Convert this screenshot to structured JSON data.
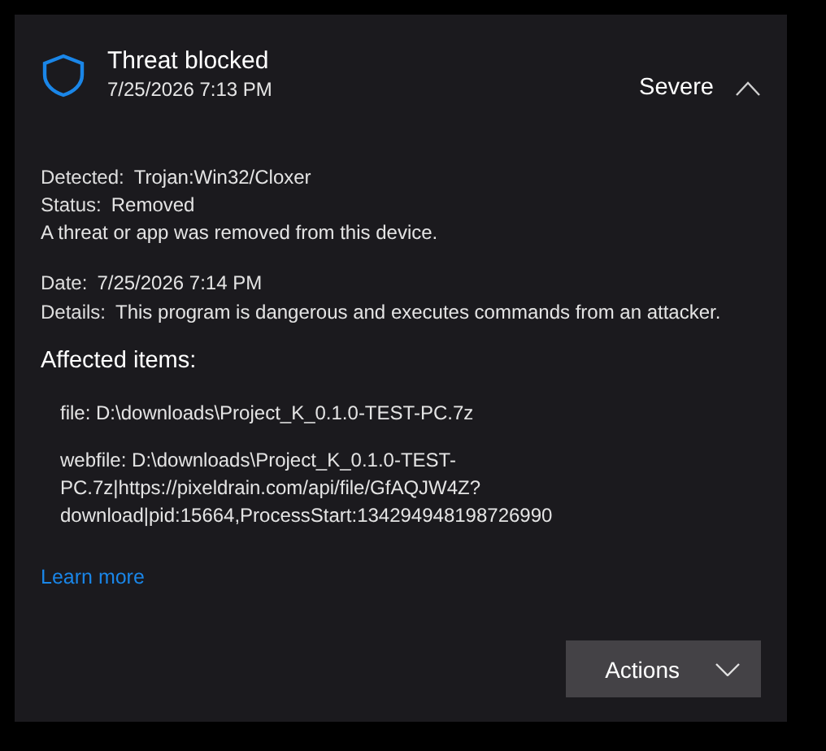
{
  "header": {
    "title": "Threat blocked",
    "timestamp": "7/25/2026 7:13 PM",
    "severity": "Severe",
    "expanded": true
  },
  "fields": [
    {
      "label": "Detected:",
      "value": "Trojan:Win32/Cloxer"
    },
    {
      "label": "Status:",
      "value": "Removed"
    }
  ],
  "message": "A threat or app was removed from this device.",
  "fields_2": [
    {
      "label": "Date:",
      "value": "7/25/2026 7:14 PM"
    },
    {
      "label": "Details:",
      "value": "This program is dangerous and executes commands from an attacker."
    }
  ],
  "affected_items": {
    "title": "Affected items:",
    "items": [
      "file: D:\\downloads\\Project_K_0.1.0-TEST-PC.7z",
      "webfile: D:\\downloads\\Project_K_0.1.0-TEST-PC.7z|https://pixeldrain.com/api/file/GfAQJW4Z?download|pid:15664,ProcessStart:134294948198726990"
    ]
  },
  "link": "Learn more",
  "actions_button": "Actions"
}
